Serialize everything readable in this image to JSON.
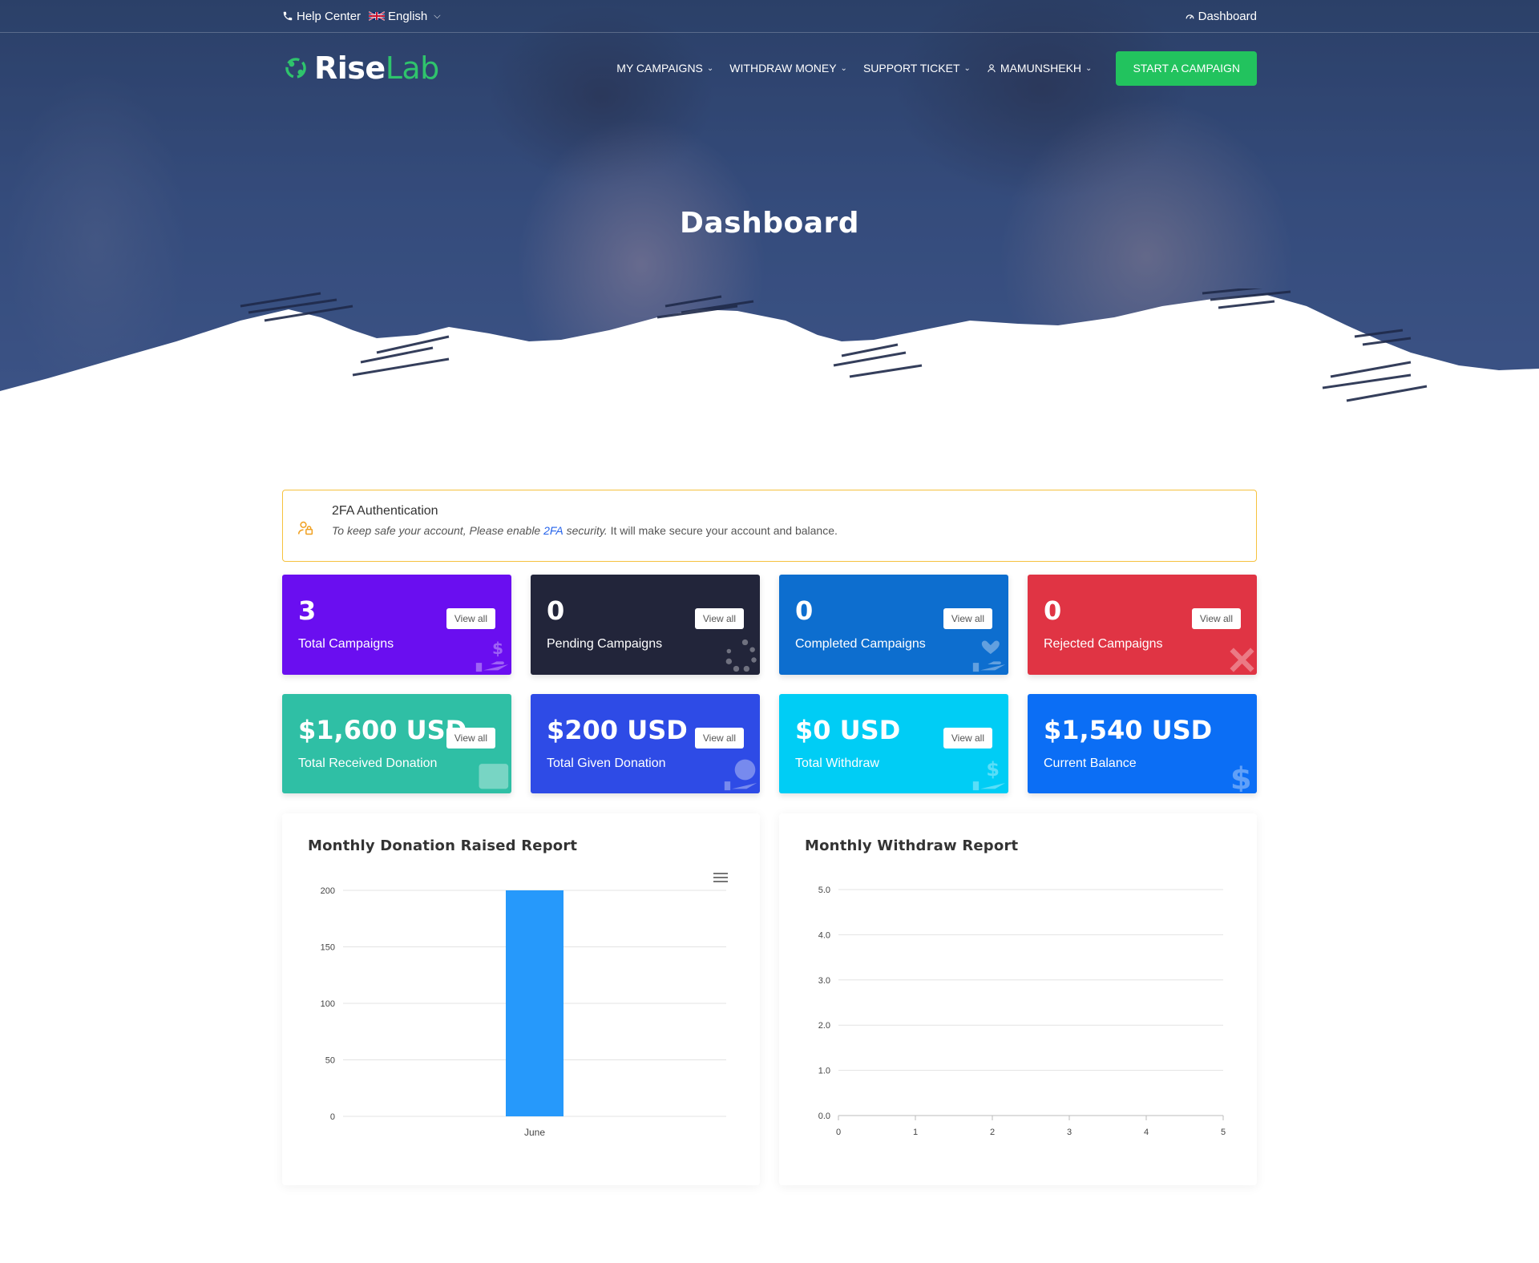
{
  "topbar": {
    "help_center": "Help Center",
    "language": "English",
    "dashboard_link": "Dashboard"
  },
  "logo": {
    "rise": "Rise",
    "lab": "Lab"
  },
  "nav": {
    "my_campaigns": "MY CAMPAIGNS",
    "withdraw_money": "WITHDRAW MONEY",
    "support_ticket": "SUPPORT TICKET",
    "user": "MAMUNSHEKH",
    "start_campaign": "START A CAMPAIGN"
  },
  "hero": {
    "title": "Dashboard"
  },
  "alert": {
    "title": "2FA Authentication",
    "text_before": "To keep safe your account, Please enable",
    "link": "2FA",
    "text_italic_after": "security.",
    "text_after": "It will make secure your account and balance."
  },
  "cards": [
    {
      "value": "3",
      "label": "Total Campaigns",
      "view": "View all",
      "color": "#6a0ef0",
      "icon": "hand-money-icon"
    },
    {
      "value": "0",
      "label": "Pending Campaigns",
      "view": "View all",
      "color": "#22253a",
      "icon": "spinner-icon"
    },
    {
      "value": "0",
      "label": "Completed Campaigns",
      "view": "View all",
      "color": "#0d6ecf",
      "icon": "hand-heart-icon"
    },
    {
      "value": "0",
      "label": "Rejected Campaigns",
      "view": "View all",
      "color": "#e03444",
      "icon": "close-icon"
    },
    {
      "value": "$1,600 USD",
      "label": "Total Received Donation",
      "view": "View all",
      "color": "#2fbfa5",
      "icon": "wallet-icon"
    },
    {
      "value": "$200 USD",
      "label": "Total Given Donation",
      "view": "View all",
      "color": "#2e4be6",
      "icon": "coin-hand-icon"
    },
    {
      "value": "$0 USD",
      "label": "Total Withdraw",
      "view": "View all",
      "color": "#00cdf5",
      "icon": "hand-dollar-icon"
    },
    {
      "value": "$1,540 USD",
      "label": "Current Balance",
      "view": "",
      "color": "#0b6ef5",
      "icon": "dollar-icon"
    }
  ],
  "charts": {
    "donation_title": "Monthly Donation Raised Report",
    "withdraw_title": "Monthly Withdraw Report"
  },
  "chart_data": [
    {
      "type": "bar",
      "title": "Monthly Donation Raised Report",
      "categories": [
        "June"
      ],
      "values": [
        200
      ],
      "ylim": [
        0,
        200
      ],
      "yticks": [
        0,
        50,
        100,
        150,
        200
      ],
      "grid": true,
      "color": "#2699fb"
    },
    {
      "type": "line",
      "title": "Monthly Withdraw Report",
      "x": [],
      "values": [],
      "xlim": [
        0,
        5
      ],
      "xticks": [
        0,
        1,
        2,
        3,
        4,
        5
      ],
      "ylim": [
        0,
        5
      ],
      "yticks": [
        "0.0",
        "1.0",
        "2.0",
        "3.0",
        "4.0",
        "5.0"
      ],
      "grid": true
    }
  ]
}
